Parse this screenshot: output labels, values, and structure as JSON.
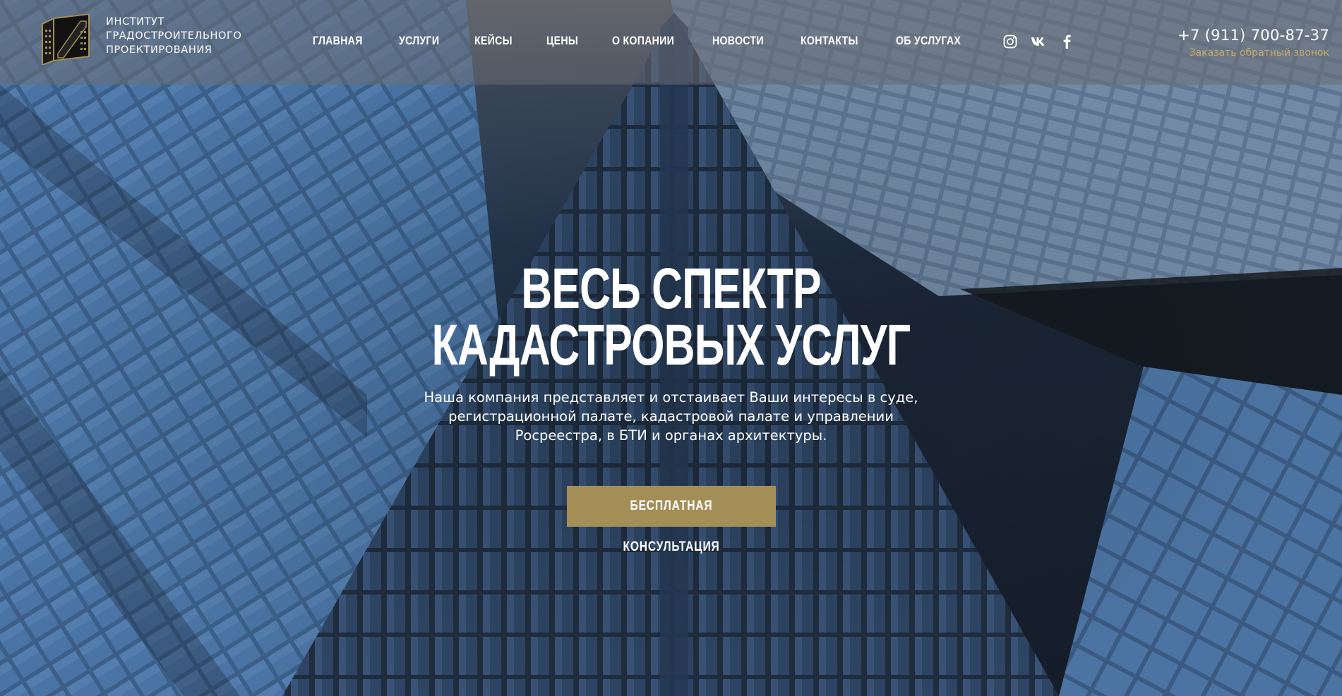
{
  "brand": {
    "logo_icon": "institute-monogram-logo",
    "name_lines": [
      "ИНСТИТУТ",
      "ГРАДОСТРОИТЕЛЬНОГО",
      "ПРОЕКТИРОВАНИЯ"
    ],
    "accent_color": "#a38e58"
  },
  "nav": {
    "items": [
      {
        "label": "ГЛАВНАЯ"
      },
      {
        "label": "УСЛУГИ"
      },
      {
        "label": "КЕЙСЫ"
      },
      {
        "label": "ЦЕНЫ"
      },
      {
        "label": "О КОПАНИИ"
      },
      {
        "label": "НОВОСТИ"
      },
      {
        "label": "КОНТАКТЫ"
      },
      {
        "label": "ОБ УСЛУГАХ"
      }
    ]
  },
  "socials": [
    {
      "icon": "instagram-icon"
    },
    {
      "icon": "vk-icon"
    },
    {
      "icon": "facebook-icon"
    }
  ],
  "contact": {
    "phone": "+7 (911) 700-87-37",
    "callback_label": "Заказать обратный звонок",
    "callback_color": "#c9a96a"
  },
  "hero": {
    "headline_lines": [
      "ВЕСЬ СПЕКТР",
      "КАДАСТРОВЫХ УСЛУГ"
    ],
    "subtitle": "Наша компания представляет и отстаивает Ваши интересы в суде, регистрационной палате, кадастровой палате и управлении Росреестра, в БТИ и органах архитектуры.",
    "cta_label": "БЕСПЛАТНАЯ КОНСУЛЬТАЦИЯ",
    "background_image": "skyscraper-glass-facade-photo"
  }
}
